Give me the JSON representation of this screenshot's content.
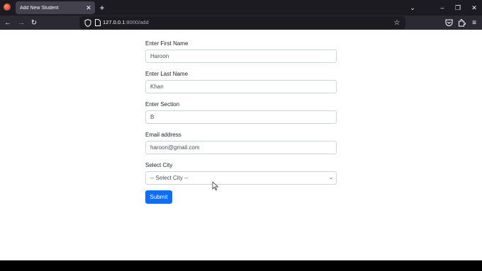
{
  "browser": {
    "tab_title": "Add New Student",
    "tab_close": "✕",
    "new_tab": "+",
    "list_tabs": "⌄",
    "window": {
      "minimize": "–",
      "maximize": "❐",
      "close": "✕"
    },
    "nav": {
      "back": "←",
      "forward": "→",
      "reload": "↻"
    },
    "url_host": "127.0.0.1",
    "url_rest": ":8000/add",
    "bookmark": "☆",
    "menu": "≡"
  },
  "form": {
    "first_name": {
      "label": "Enter First Name",
      "value": "Haroon"
    },
    "last_name": {
      "label": "Enter Last Name",
      "value": "Khan"
    },
    "section": {
      "label": "Enter Section",
      "value": "B"
    },
    "email": {
      "label": "Email address",
      "value": "haroon@gmail.com"
    },
    "city": {
      "label": "Select City",
      "selected": "-- Select City --",
      "chevron": "⌄"
    },
    "submit_label": "Submit"
  }
}
